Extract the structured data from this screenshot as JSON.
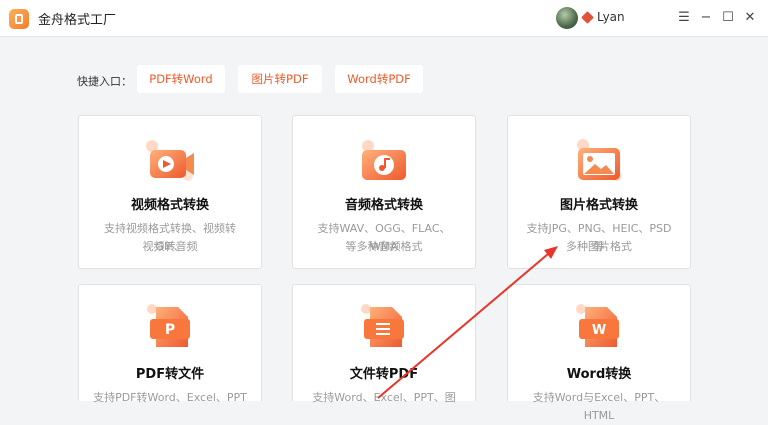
{
  "app": {
    "title": "金舟格式工厂"
  },
  "user": {
    "name": "Lyan"
  },
  "window_controls": {
    "menu": "☰",
    "minimize": "−",
    "maximize": "☐",
    "close": "✕"
  },
  "quick": {
    "label": "快捷入口：",
    "items": [
      "PDF转Word",
      "图片转PDF",
      "Word转PDF"
    ]
  },
  "cards": [
    {
      "title": "视频格式转换",
      "desc1": "支持视频格式转换、视频转GIF、",
      "desc2": "视频转音频",
      "icon": "video-icon"
    },
    {
      "title": "音频格式转换",
      "desc1": "支持WAV、OGG、FLAC、WMA",
      "desc2": "等多种音频格式",
      "icon": "music-icon"
    },
    {
      "title": "图片格式转换",
      "desc1": "支持JPG、PNG、HEIC、PSD等",
      "desc2": "多种图片格式",
      "icon": "image-icon"
    },
    {
      "title": "PDF转文件",
      "desc1": "支持PDF转Word、Excel、PPT",
      "desc2": "",
      "icon": "ppt-icon"
    },
    {
      "title": "文件转PDF",
      "desc1": "支持Word、Excel、PPT、图",
      "desc2": "",
      "icon": "document-icon"
    },
    {
      "title": "Word转换",
      "desc1": "支持Word与Excel、PPT、HTML",
      "desc2": "",
      "icon": "word-icon"
    }
  ],
  "colors": {
    "accent": "#f05a28",
    "icon_gradient_start": "#ffb07a",
    "icon_gradient_end": "#ee5a2e",
    "annotation_arrow": "#e8352a"
  }
}
